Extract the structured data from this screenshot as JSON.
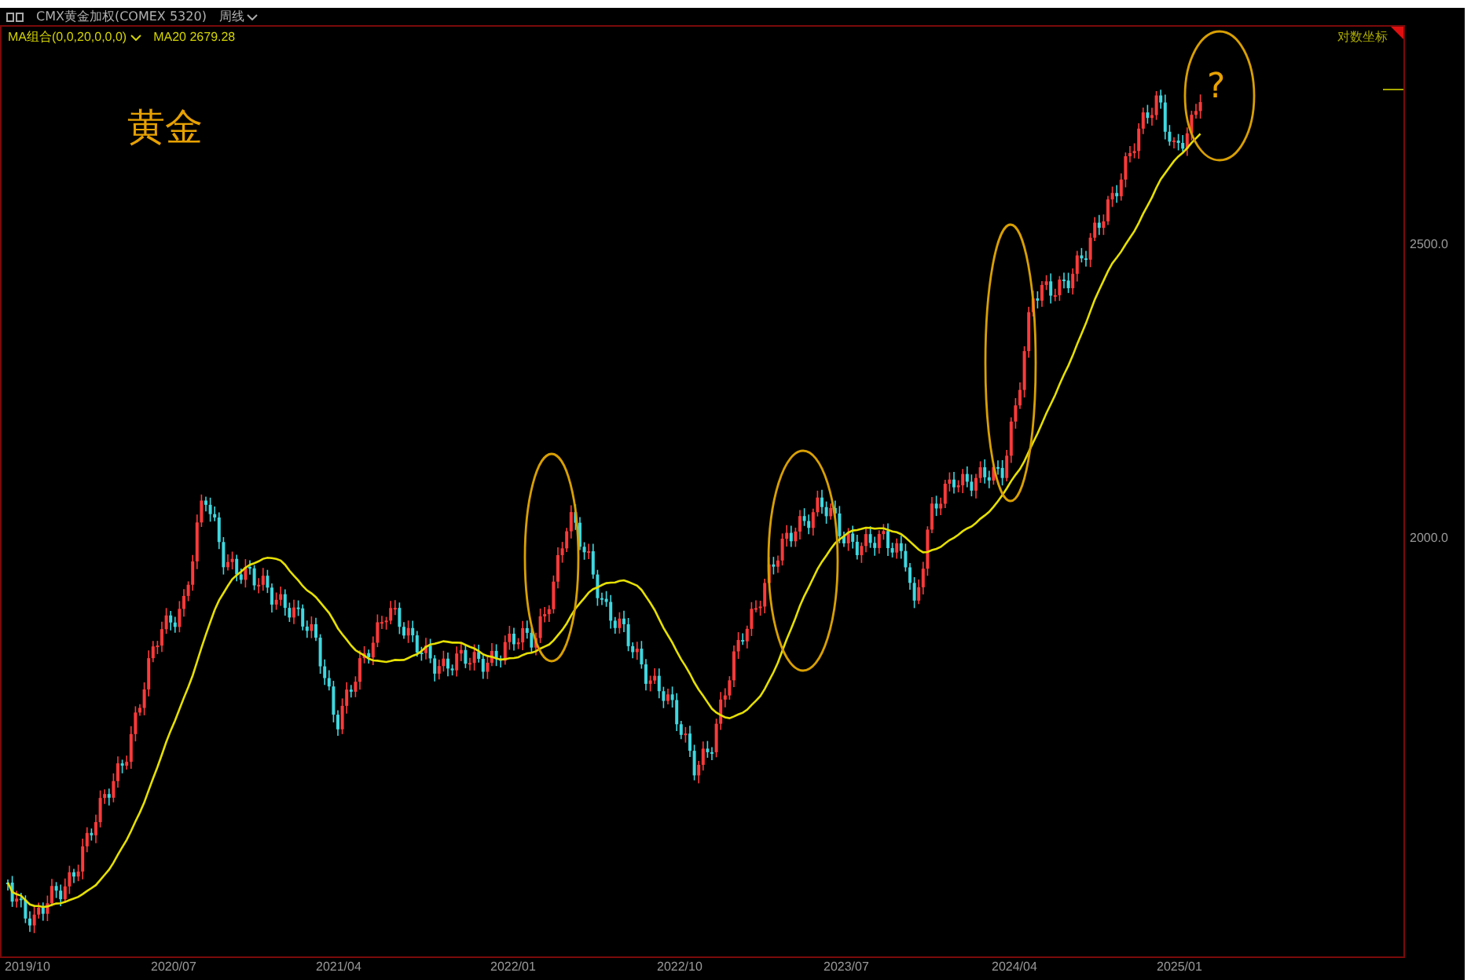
{
  "header": {
    "instrument": "CMX黄金加权(COMEX 5320)",
    "period": "周线"
  },
  "indicator": {
    "name": "MA组合(0,0,20,0,0,0)",
    "reading": "MA20 2679.28"
  },
  "title": "黄金",
  "scale_label": "对数坐标",
  "y_axis": [
    "2500.0",
    "2000.0"
  ],
  "x_axis": [
    "2019/10",
    "2020/07",
    "2021/04",
    "2022/01",
    "2022/10",
    "2023/07",
    "2024/04",
    "2025/01"
  ],
  "question_mark": "?"
}
